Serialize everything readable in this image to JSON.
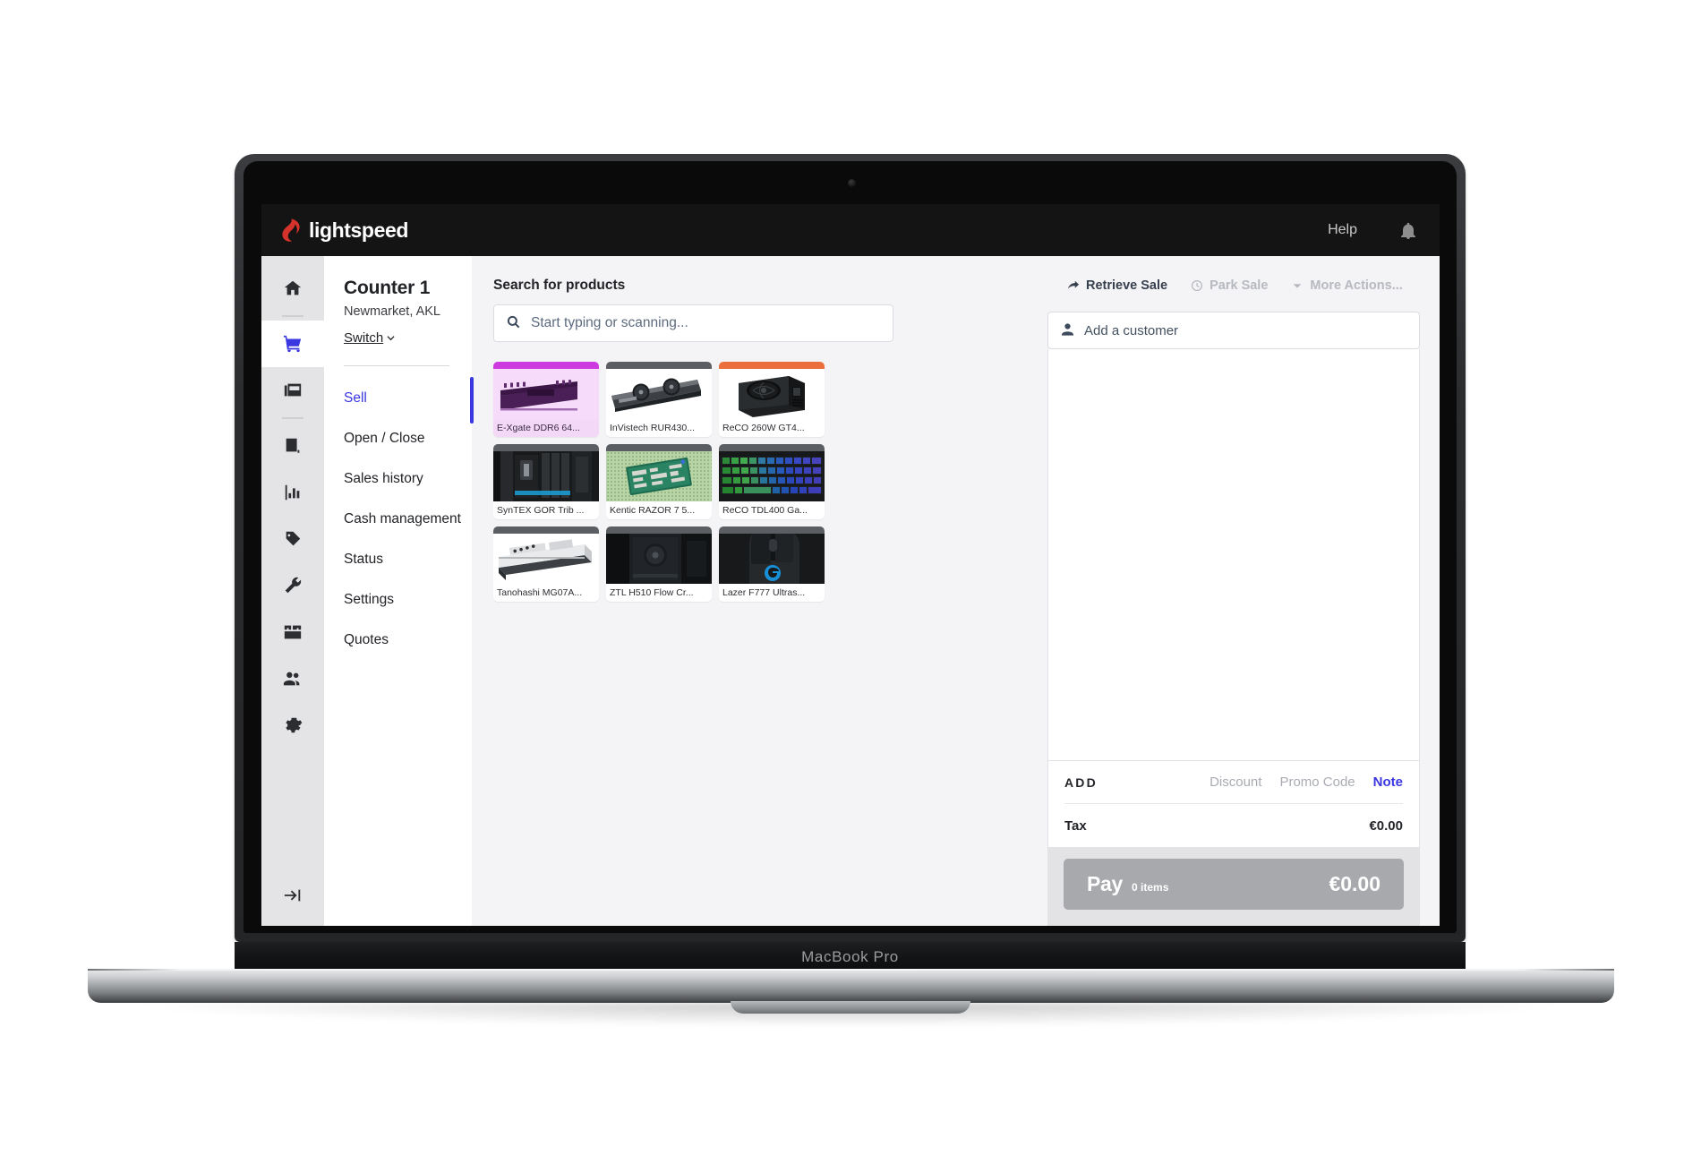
{
  "device": {
    "model_label": "MacBook Pro"
  },
  "topbar": {
    "brand": "lightspeed",
    "brand_icon": "lightspeed-flame-logo",
    "help_label": "Help",
    "bell_icon": "bell-icon"
  },
  "rail": {
    "items": [
      {
        "icon": "home-icon",
        "name": "home"
      },
      {
        "icon": "shopping-cart-icon",
        "name": "sell",
        "active": true
      },
      {
        "icon": "register-tiles-icon",
        "name": "register"
      },
      {
        "icon": "ledger-book-icon",
        "name": "catalog"
      },
      {
        "icon": "bar-chart-icon",
        "name": "reporting"
      },
      {
        "icon": "price-tag-icon",
        "name": "products"
      },
      {
        "icon": "wrench-icon",
        "name": "workorders"
      },
      {
        "icon": "inventory-box-icon",
        "name": "inventory"
      },
      {
        "icon": "people-icon",
        "name": "customers"
      },
      {
        "icon": "gear-icon",
        "name": "settings"
      }
    ],
    "collapse_icon": "arrow-to-bar-icon"
  },
  "sidebar": {
    "counter_title": "Counter 1",
    "counter_location": "Newmarket, AKL",
    "switch_label": "Switch",
    "switch_icon": "chevron-down-icon",
    "items": [
      {
        "label": "Sell",
        "active": true
      },
      {
        "label": "Open / Close",
        "active": false
      },
      {
        "label": "Sales history",
        "active": false
      },
      {
        "label": "Cash management",
        "active": false
      },
      {
        "label": "Status",
        "active": false
      },
      {
        "label": "Settings",
        "active": false
      },
      {
        "label": "Quotes",
        "active": false
      }
    ]
  },
  "products": {
    "search_heading": "Search for products",
    "search_placeholder": "Start typing or scanning...",
    "search_icon": "search-icon",
    "search_value": "",
    "tiles": [
      {
        "label": "E-Xgate DDR6 64...",
        "strip_color": "#cc3ae0",
        "selected": true,
        "image": "ram-module"
      },
      {
        "label": "InVistech RUR430...",
        "strip_color": "#5b5f63",
        "selected": false,
        "image": "graphics-card"
      },
      {
        "label": "ReCO 260W GT4...",
        "strip_color": "#ea6f3c",
        "selected": false,
        "image": "power-supply"
      },
      {
        "label": "SynTEX GOR Trib ...",
        "strip_color": "#5b5f63",
        "selected": false,
        "image": "motherboard"
      },
      {
        "label": "Kentic RAZOR 7 5...",
        "strip_color": "#5b5f63",
        "selected": false,
        "image": "cpu-chip"
      },
      {
        "label": "ReCO TDL400 Ga...",
        "strip_color": "#5b5f63",
        "selected": false,
        "image": "rgb-keyboard"
      },
      {
        "label": "Tanohashi MG07A...",
        "strip_color": "#5b5f63",
        "selected": false,
        "image": "hard-drive"
      },
      {
        "label": "ZTL H510 Flow Cr...",
        "strip_color": "#5b5f63",
        "selected": false,
        "image": "pc-case"
      },
      {
        "label": "Lazer F777 Ultras...",
        "strip_color": "#5b5f63",
        "selected": false,
        "image": "gaming-mouse"
      }
    ]
  },
  "cart": {
    "actions": [
      {
        "label": "Retrieve Sale",
        "icon": "arrow-curve-icon",
        "enabled": true
      },
      {
        "label": "Park Sale",
        "icon": "clock-history-icon",
        "enabled": false
      },
      {
        "label": "More Actions...",
        "icon": "caret-down-icon",
        "enabled": false
      }
    ],
    "customer_placeholder": "Add a customer",
    "customer_icon": "person-icon",
    "add_label": "ADD",
    "discount_label": "Discount",
    "promo_label": "Promo Code",
    "note_label": "Note",
    "tax_label": "Tax",
    "tax_value": "€0.00",
    "pay_label": "Pay",
    "pay_items": "0 items",
    "pay_total": "€0.00"
  },
  "colors": {
    "accent": "#3b37e0",
    "brand_red": "#d6322c",
    "topbar_bg": "#141414",
    "pay_disabled": "#a8a9ac",
    "selected_tile": "#f3d8f7"
  }
}
